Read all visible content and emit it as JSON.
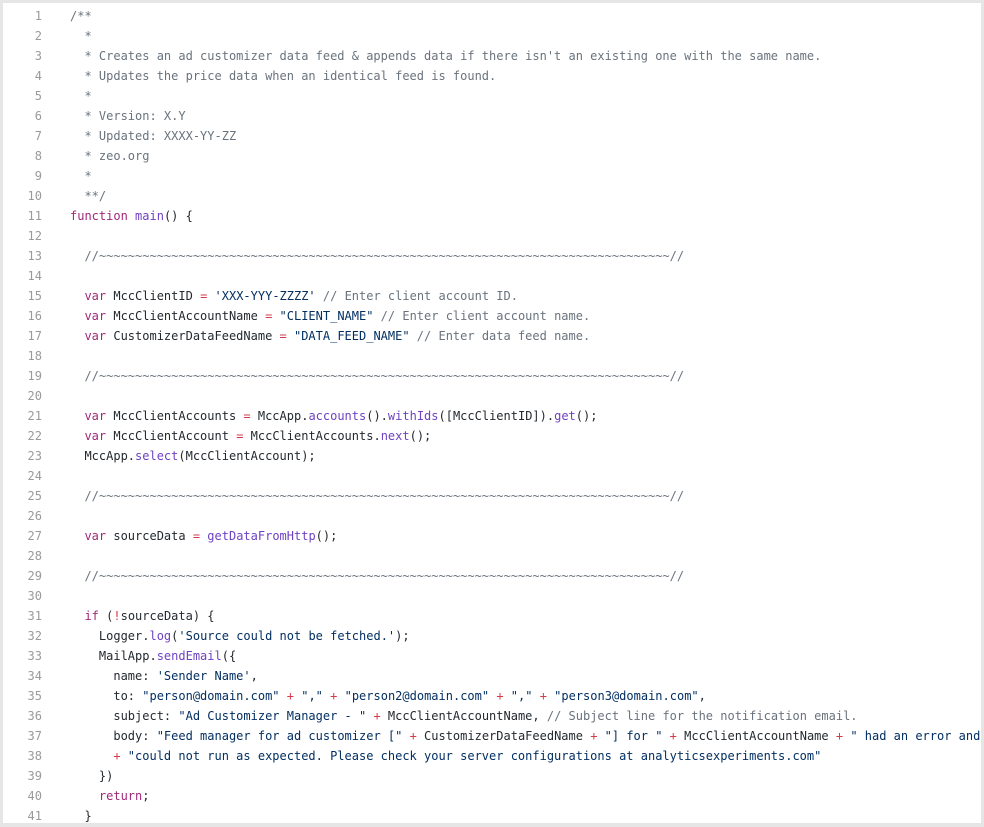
{
  "colors": {
    "comment": "#6a737d",
    "keyword": "#a0287a",
    "function": "#6f42c1",
    "string": "#032f62",
    "operator": "#d73a49",
    "text": "#24292e",
    "line_number": "#9a9a9a",
    "background": "#ffffff",
    "frame": "#e6e6e6"
  },
  "lines": [
    {
      "n": "1",
      "tokens": [
        [
          "c",
          "/**"
        ]
      ]
    },
    {
      "n": "2",
      "tokens": [
        [
          "c",
          "  *"
        ]
      ]
    },
    {
      "n": "3",
      "tokens": [
        [
          "c",
          "  * Creates an ad customizer data feed & appends data if there isn't an existing one with the same name."
        ]
      ]
    },
    {
      "n": "4",
      "tokens": [
        [
          "c",
          "  * Updates the price data when an identical feed is found."
        ]
      ]
    },
    {
      "n": "5",
      "tokens": [
        [
          "c",
          "  *"
        ]
      ]
    },
    {
      "n": "6",
      "tokens": [
        [
          "c",
          "  * Version: X.Y"
        ]
      ]
    },
    {
      "n": "7",
      "tokens": [
        [
          "c",
          "  * Updated: XXXX-YY-ZZ"
        ]
      ]
    },
    {
      "n": "8",
      "tokens": [
        [
          "c",
          "  * zeo.org"
        ]
      ]
    },
    {
      "n": "9",
      "tokens": [
        [
          "c",
          "  *"
        ]
      ]
    },
    {
      "n": "10",
      "tokens": [
        [
          "c",
          "  **/"
        ]
      ]
    },
    {
      "n": "11",
      "tokens": [
        [
          "k",
          "function "
        ],
        [
          "f",
          "main"
        ],
        [
          "p",
          "() {"
        ]
      ]
    },
    {
      "n": "12",
      "tokens": []
    },
    {
      "n": "13",
      "tokens": [
        [
          "c",
          "  //~~~~~~~~~~~~~~~~~~~~~~~~~~~~~~~~~~~~~~~~~~~~~~~~~~~~~~~~~~~~~~~~~~~~~~~~~~~~~~~//"
        ]
      ]
    },
    {
      "n": "14",
      "tokens": []
    },
    {
      "n": "15",
      "tokens": [
        [
          "k",
          "  var "
        ],
        [
          "p",
          "MccClientID "
        ],
        [
          "o",
          "= "
        ],
        [
          "s",
          "'XXX-YYY-ZZZZ'"
        ],
        [
          "c",
          " // Enter client account ID."
        ]
      ]
    },
    {
      "n": "16",
      "tokens": [
        [
          "k",
          "  var "
        ],
        [
          "p",
          "MccClientAccountName "
        ],
        [
          "o",
          "= "
        ],
        [
          "s",
          "\"CLIENT_NAME\""
        ],
        [
          "c",
          " // Enter client account name."
        ]
      ]
    },
    {
      "n": "17",
      "tokens": [
        [
          "k",
          "  var "
        ],
        [
          "p",
          "CustomizerDataFeedName "
        ],
        [
          "o",
          "= "
        ],
        [
          "s",
          "\"DATA_FEED_NAME\""
        ],
        [
          "c",
          " // Enter data feed name."
        ]
      ]
    },
    {
      "n": "18",
      "tokens": []
    },
    {
      "n": "19",
      "tokens": [
        [
          "c",
          "  //~~~~~~~~~~~~~~~~~~~~~~~~~~~~~~~~~~~~~~~~~~~~~~~~~~~~~~~~~~~~~~~~~~~~~~~~~~~~~~~//"
        ]
      ]
    },
    {
      "n": "20",
      "tokens": []
    },
    {
      "n": "21",
      "tokens": [
        [
          "k",
          "  var "
        ],
        [
          "p",
          "MccClientAccounts "
        ],
        [
          "o",
          "= "
        ],
        [
          "p",
          "MccApp."
        ],
        [
          "f",
          "accounts"
        ],
        [
          "p",
          "()."
        ],
        [
          "f",
          "withIds"
        ],
        [
          "p",
          "([MccClientID])."
        ],
        [
          "f",
          "get"
        ],
        [
          "p",
          "();"
        ]
      ]
    },
    {
      "n": "22",
      "tokens": [
        [
          "k",
          "  var "
        ],
        [
          "p",
          "MccClientAccount "
        ],
        [
          "o",
          "= "
        ],
        [
          "p",
          "MccClientAccounts."
        ],
        [
          "f",
          "next"
        ],
        [
          "p",
          "();"
        ]
      ]
    },
    {
      "n": "23",
      "tokens": [
        [
          "p",
          "  MccApp."
        ],
        [
          "f",
          "select"
        ],
        [
          "p",
          "(MccClientAccount);"
        ]
      ]
    },
    {
      "n": "24",
      "tokens": []
    },
    {
      "n": "25",
      "tokens": [
        [
          "c",
          "  //~~~~~~~~~~~~~~~~~~~~~~~~~~~~~~~~~~~~~~~~~~~~~~~~~~~~~~~~~~~~~~~~~~~~~~~~~~~~~~~//"
        ]
      ]
    },
    {
      "n": "26",
      "tokens": []
    },
    {
      "n": "27",
      "tokens": [
        [
          "k",
          "  var "
        ],
        [
          "p",
          "sourceData "
        ],
        [
          "o",
          "= "
        ],
        [
          "f",
          "getDataFromHttp"
        ],
        [
          "p",
          "();"
        ]
      ]
    },
    {
      "n": "28",
      "tokens": []
    },
    {
      "n": "29",
      "tokens": [
        [
          "c",
          "  //~~~~~~~~~~~~~~~~~~~~~~~~~~~~~~~~~~~~~~~~~~~~~~~~~~~~~~~~~~~~~~~~~~~~~~~~~~~~~~~//"
        ]
      ]
    },
    {
      "n": "30",
      "tokens": []
    },
    {
      "n": "31",
      "tokens": [
        [
          "k",
          "  if "
        ],
        [
          "p",
          "("
        ],
        [
          "o",
          "!"
        ],
        [
          "p",
          "sourceData) {"
        ]
      ]
    },
    {
      "n": "32",
      "tokens": [
        [
          "p",
          "    Logger."
        ],
        [
          "f",
          "log"
        ],
        [
          "p",
          "("
        ],
        [
          "s",
          "'Source could not be fetched.'"
        ],
        [
          "p",
          ");"
        ]
      ]
    },
    {
      "n": "33",
      "tokens": [
        [
          "p",
          "    MailApp."
        ],
        [
          "f",
          "sendEmail"
        ],
        [
          "p",
          "({"
        ]
      ]
    },
    {
      "n": "34",
      "tokens": [
        [
          "p",
          "      name: "
        ],
        [
          "s",
          "'Sender Name'"
        ],
        [
          "p",
          ","
        ]
      ]
    },
    {
      "n": "35",
      "tokens": [
        [
          "p",
          "      to: "
        ],
        [
          "s",
          "\"person@domain.com\""
        ],
        [
          "o",
          " + "
        ],
        [
          "s",
          "\",\""
        ],
        [
          "o",
          " + "
        ],
        [
          "s",
          "\"person2@domain.com\""
        ],
        [
          "o",
          " + "
        ],
        [
          "s",
          "\",\""
        ],
        [
          "o",
          " + "
        ],
        [
          "s",
          "\"person3@domain.com\""
        ],
        [
          "p",
          ","
        ]
      ]
    },
    {
      "n": "36",
      "tokens": [
        [
          "p",
          "      subject: "
        ],
        [
          "s",
          "\"Ad Customizer Manager - \""
        ],
        [
          "o",
          " + "
        ],
        [
          "p",
          "MccClientAccountName, "
        ],
        [
          "c",
          "// Subject line for the notification email."
        ]
      ]
    },
    {
      "n": "37",
      "tokens": [
        [
          "p",
          "      body: "
        ],
        [
          "s",
          "\"Feed manager for ad customizer [\""
        ],
        [
          "o",
          " + "
        ],
        [
          "p",
          "CustomizerDataFeedName "
        ],
        [
          "o",
          "+ "
        ],
        [
          "s",
          "\"] for \""
        ],
        [
          "o",
          " + "
        ],
        [
          "p",
          "MccClientAccountName "
        ],
        [
          "o",
          "+ "
        ],
        [
          "s",
          "\" had an error and \""
        ]
      ]
    },
    {
      "n": "38",
      "tokens": [
        [
          "o",
          "      + "
        ],
        [
          "s",
          "\"could not run as expected. Please check your server configurations at analyticsexperiments.com\""
        ]
      ]
    },
    {
      "n": "39",
      "tokens": [
        [
          "p",
          "    })"
        ]
      ]
    },
    {
      "n": "40",
      "tokens": [
        [
          "k",
          "    return"
        ],
        [
          "p",
          ";"
        ]
      ]
    },
    {
      "n": "41",
      "tokens": [
        [
          "p",
          "  }"
        ]
      ]
    }
  ]
}
